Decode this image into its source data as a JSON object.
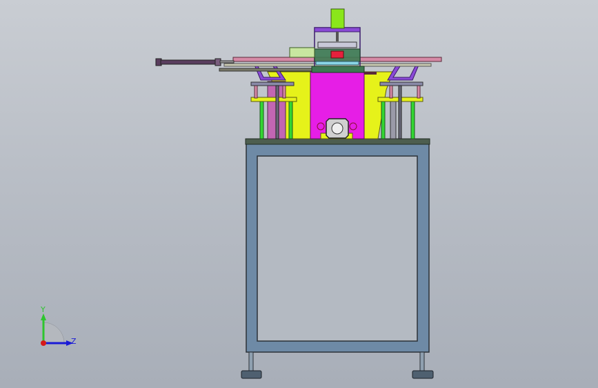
{
  "viewport": {
    "background_top": "#c9cdd3",
    "background_bottom": "#a8aeb8"
  },
  "triad": {
    "y_label": "Y",
    "z_label": "Z",
    "y_color": "#2ec52e",
    "z_color": "#1a1ad6",
    "x_color": "#d61a1a"
  },
  "model": {
    "colors": {
      "frame": "#6e8aa6",
      "frame_edge": "#2b3137",
      "top_plate": "#4d5e4f",
      "magenta": "#e61ee6",
      "yellow": "#e6f21a",
      "mauve": "#c266b3",
      "green": "#33d633",
      "purple": "#8a4ad6",
      "rod": "#5a3d5e",
      "lime": "#8ae61a",
      "pink": "#d68aa6",
      "dark_green": "#3d7a52",
      "red": "#e6203d",
      "foot": "#5a6e80"
    }
  }
}
